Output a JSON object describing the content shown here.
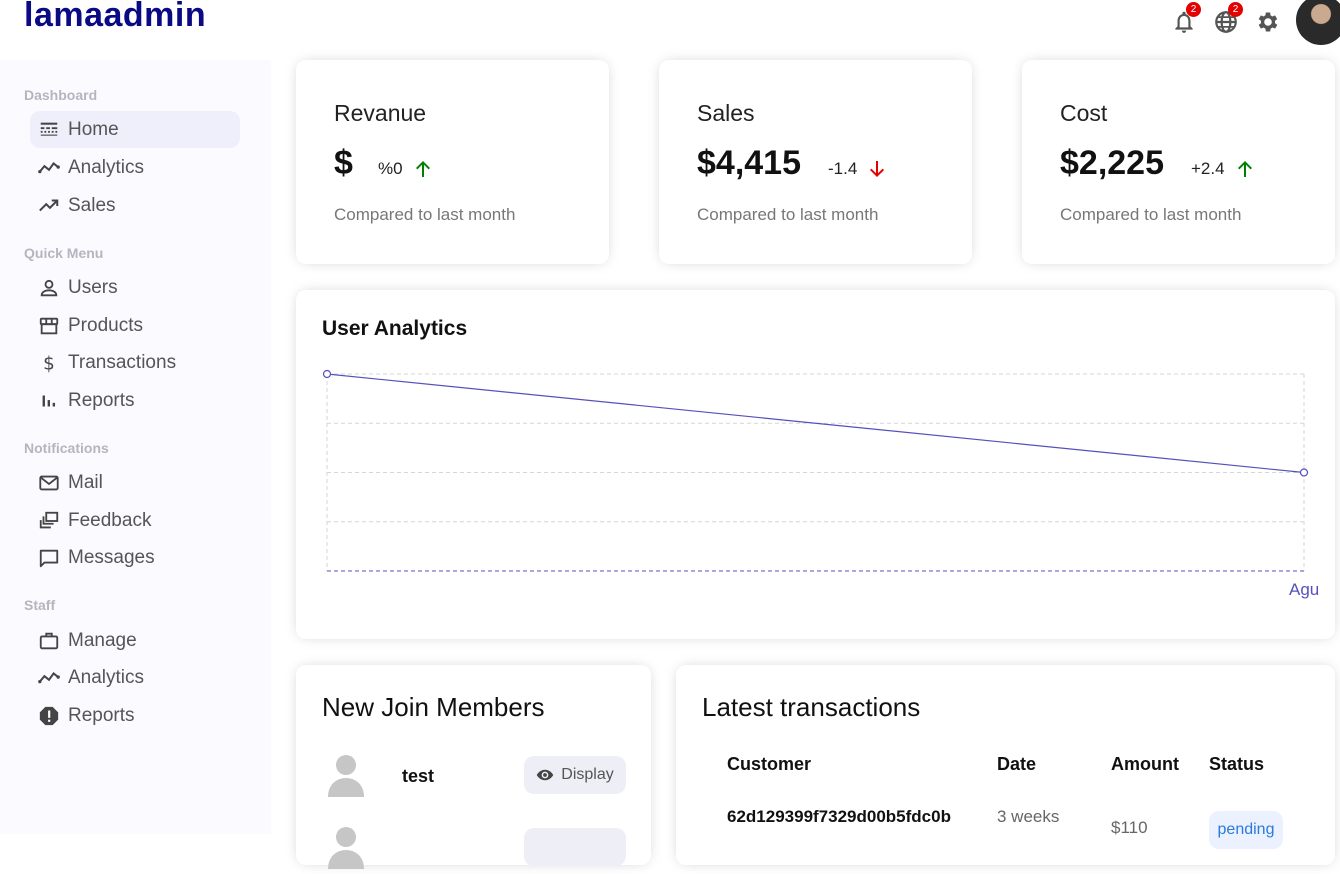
{
  "app": {
    "logo": "lamaadmin"
  },
  "topbar": {
    "notifications_badge": "2",
    "language_badge": "2"
  },
  "sidebar": {
    "sections": [
      {
        "title": "Dashboard",
        "items": [
          "Home",
          "Analytics",
          "Sales"
        ]
      },
      {
        "title": "Quick Menu",
        "items": [
          "Users",
          "Products",
          "Transactions",
          "Reports"
        ]
      },
      {
        "title": "Notifications",
        "items": [
          "Mail",
          "Feedback",
          "Messages"
        ]
      },
      {
        "title": "Staff",
        "items": [
          "Manage",
          "Analytics",
          "Reports"
        ]
      }
    ]
  },
  "featured": [
    {
      "title": "Revanue",
      "money": "$",
      "rate": "%0",
      "trend": "up",
      "sub": "Compared to last month"
    },
    {
      "title": "Sales",
      "money": "$4,415",
      "rate": "-1.4",
      "trend": "down",
      "sub": "Compared to last month"
    },
    {
      "title": "Cost",
      "money": "$2,225",
      "rate": "+2.4",
      "trend": "up",
      "sub": "Compared to last month"
    }
  ],
  "colors": {
    "up": "#008000",
    "down": "#e30000",
    "line": "#5550bd",
    "brand": "#0a0a85"
  },
  "chart_data": {
    "type": "line",
    "title": "User Analytics",
    "categories": [
      "",
      "Agu"
    ],
    "series": [
      {
        "values": [
          4,
          2
        ]
      }
    ],
    "ylim": [
      0,
      4
    ],
    "grid": true
  },
  "widget_sm": {
    "title": "New Join Members",
    "members": [
      {
        "name": "test",
        "button": "Display"
      }
    ]
  },
  "widget_lg": {
    "title": "Latest transactions",
    "headers": {
      "customer": "Customer",
      "date": "Date",
      "amount": "Amount",
      "status": "Status"
    },
    "rows": [
      {
        "customer": "62d129399f7329d00b5fdc0b",
        "date": "3 weeks",
        "amount": "$110",
        "status": "pending"
      }
    ]
  }
}
